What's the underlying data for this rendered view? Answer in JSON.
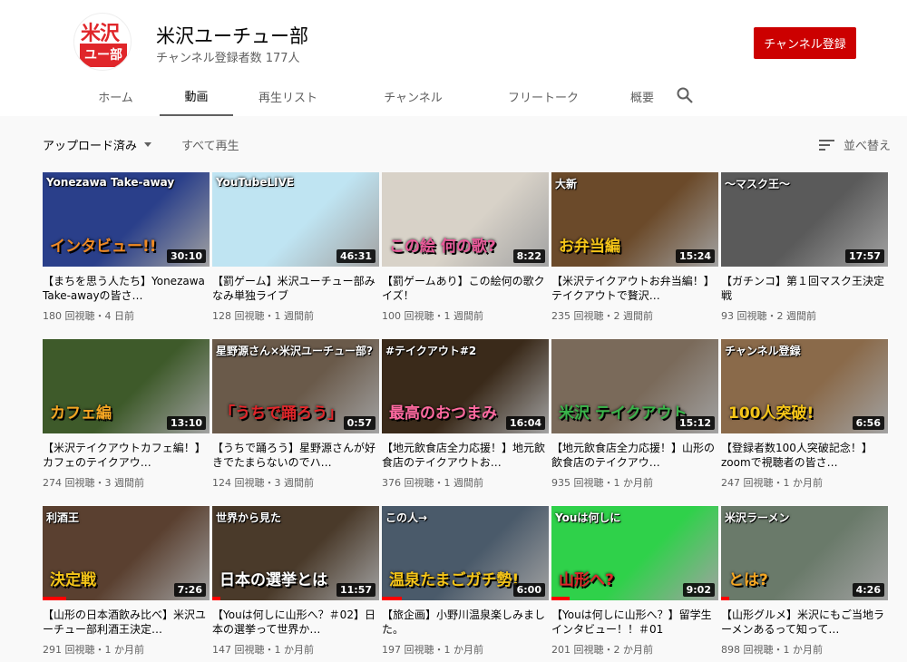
{
  "channel": {
    "logo_line1": "米沢",
    "logo_line2": "ユー部",
    "name": "米沢ユーチュー部",
    "subscribers": "チャンネル登録者数 177人",
    "subscribe_label": "チャンネル登録"
  },
  "tabs": [
    {
      "label": "ホーム"
    },
    {
      "label": "動画"
    },
    {
      "label": "再生リスト"
    },
    {
      "label": "チャンネル"
    },
    {
      "label": "フリートーク"
    },
    {
      "label": "概要"
    }
  ],
  "active_tab": "動画",
  "filter": {
    "uploaded_label": "アップロード済み",
    "play_all_label": "すべて再生",
    "sort_label": "並べ替え"
  },
  "videos": [
    {
      "title": "【まちを思う人たち】Yonezawa Take-awayの皆さ…",
      "meta": "180 回視聴・4 日前",
      "duration": "30:10",
      "thumb_title": "Yonezawa Take-away",
      "thumb_caption": "インタビュー!!",
      "bg": "#2a3f8a",
      "accent": "#f08a24",
      "progress": 0
    },
    {
      "title": "【罰ゲーム】米沢ユーチュー部みなみ単独ライブ",
      "meta": "128 回視聴・1 週間前",
      "duration": "46:31",
      "thumb_title": "YouTubeLIVE",
      "thumb_caption": "",
      "bg": "#bfe4f2",
      "accent": "#1fa64a",
      "progress": 0
    },
    {
      "title": "【罰ゲームあり】この絵何の歌クイズ！",
      "meta": "100 回視聴・1 週間前",
      "duration": "8:22",
      "thumb_title": "",
      "thumb_caption": "この絵 何の歌?",
      "bg": "#d8d2c8",
      "accent": "#e85a9a",
      "progress": 0
    },
    {
      "title": "【米沢テイクアウトお弁当編！】テイクアウトで贅沢…",
      "meta": "235 回視聴・2 週間前",
      "duration": "15:24",
      "thumb_title": "大新",
      "thumb_caption": "お弁当編",
      "bg": "#6b4a2a",
      "accent": "#f5c518",
      "progress": 0
    },
    {
      "title": "【ガチンコ】第１回マスク王決定戦",
      "meta": "93 回視聴・2 週間前",
      "duration": "17:57",
      "thumb_title": "～マスク王～",
      "thumb_caption": "",
      "bg": "#5a5a5a",
      "accent": "#8fd0e8",
      "progress": 0
    },
    {
      "title": "【米沢テイクアウトカフェ編！】カフェのテイクアウ…",
      "meta": "274 回視聴・3 週間前",
      "duration": "13:10",
      "thumb_title": "",
      "thumb_caption": "カフェ編",
      "bg": "#3e5a2a",
      "accent": "#f5a623",
      "progress": 0
    },
    {
      "title": "【うちで踊ろう】星野源さんが好きでたまらないのでハ…",
      "meta": "124 回視聴・3 週間前",
      "duration": "0:57",
      "thumb_title": "星野源さん×米沢ユーチュー部?",
      "thumb_caption": "「うちで踊ろう」",
      "bg": "#6a5a4a",
      "accent": "#e0262a",
      "progress": 0
    },
    {
      "title": "【地元飲食店全力応援！】地元飲食店のテイクアウトお…",
      "meta": "376 回視聴・1 週間前",
      "duration": "16:04",
      "thumb_title": "#テイクアウト#2",
      "thumb_caption": "最高のおつまみ",
      "bg": "#3a2a1a",
      "accent": "#ff6aa0",
      "progress": 0
    },
    {
      "title": "【地元飲食店全力応援！】山形の飲食店のテイクアウ…",
      "meta": "935 回視聴・1 か月前",
      "duration": "15:12",
      "thumb_title": "",
      "thumb_caption": "米沢 テイクアウト",
      "bg": "#7a6a5a",
      "accent": "#39b54a",
      "progress": 0
    },
    {
      "title": "【登録者数100人突破記念！】zoomで視聴者の皆さ…",
      "meta": "247 回視聴・1 か月前",
      "duration": "6:56",
      "thumb_title": "チャンネル登録",
      "thumb_caption": "100人突破!",
      "bg": "#8a6a4a",
      "accent": "#f5c518",
      "progress": 0
    },
    {
      "title": "【山形の日本酒飲み比べ】米沢ユーチュー部利酒王決定…",
      "meta": "291 回視聴・1 か月前",
      "duration": "7:26",
      "thumb_title": "利酒王",
      "thumb_caption": "決定戦",
      "bg": "#5a4030",
      "accent": "#f5c518",
      "progress": 0.14
    },
    {
      "title": "【Youは何しに山形へ？＃02】日本の選挙って世界か…",
      "meta": "147 回視聴・1 か月前",
      "duration": "11:57",
      "thumb_title": "世界から見た",
      "thumb_caption": "日本の選挙とは",
      "bg": "#4a3a2a",
      "accent": "#ffffff",
      "progress": 0.05
    },
    {
      "title": "【旅企画】小野川温泉楽しみました。",
      "meta": "197 回視聴・1 か月前",
      "duration": "6:00",
      "thumb_title": "この人→",
      "thumb_caption": "温泉たまごガチ勢!",
      "bg": "#4a5a6a",
      "accent": "#f5c518",
      "progress": 0.12
    },
    {
      "title": "【Youは何しに山形へ？】留学生インタビュー！！＃01",
      "meta": "201 回視聴・2 か月前",
      "duration": "9:02",
      "thumb_title": "Youは何しに",
      "thumb_caption": "山形へ?",
      "bg": "#2fd14a",
      "accent": "#e0262a",
      "progress": 0.11
    },
    {
      "title": "【山形グルメ】米沢にもご当地ラーメンあるって知って…",
      "meta": "898 回視聴・1 か月前",
      "duration": "4:26",
      "thumb_title": "米沢ラーメン",
      "thumb_caption": "とは?",
      "bg": "#6a7a6a",
      "accent": "#f5a623",
      "progress": 0.05
    }
  ]
}
